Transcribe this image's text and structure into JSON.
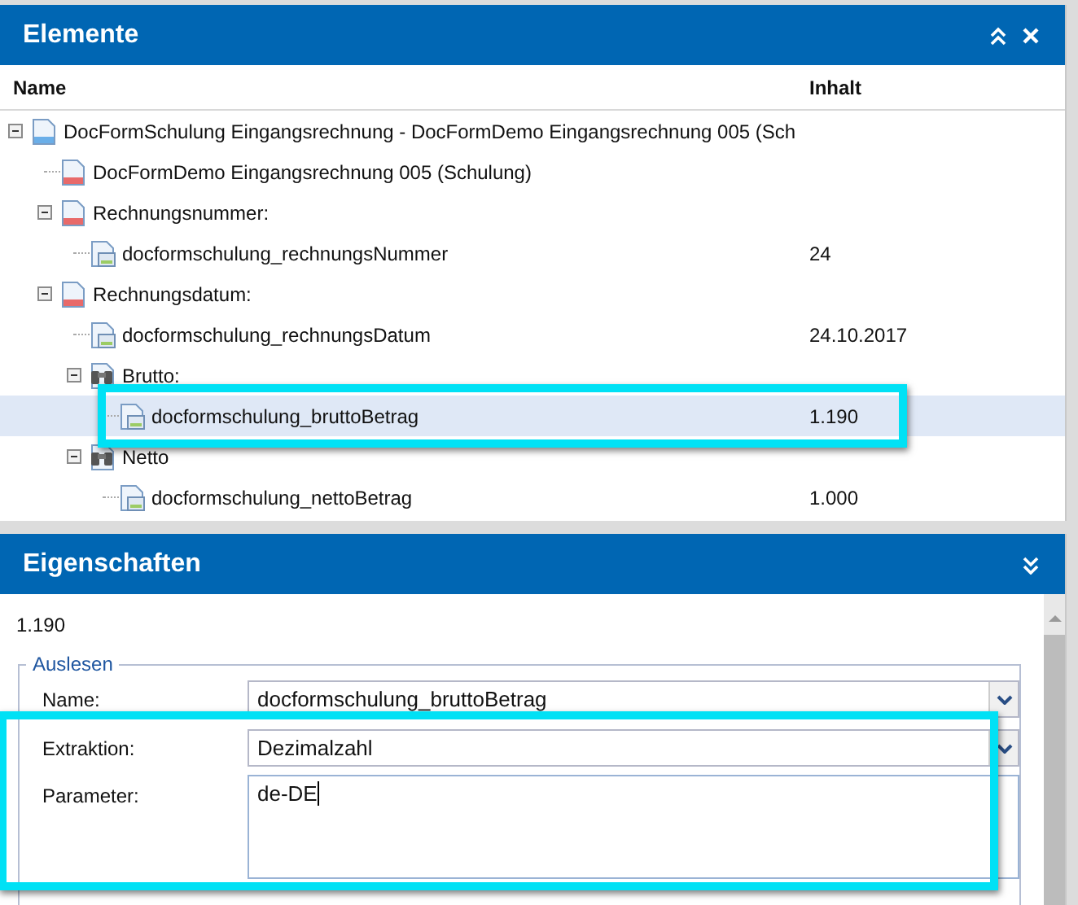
{
  "elements_panel": {
    "title": "Elemente",
    "columns": [
      "Name",
      "Inhalt"
    ],
    "tree": [
      {
        "label": "DocFormSchulung Eingangsrechnung - DocFormDemo Eingangsrechnung 005 (Sch",
        "kind": "doc-blue",
        "expanded": true,
        "selected": false,
        "children": [
          {
            "label": "DocFormDemo Eingangsrechnung 005 (Schulung)",
            "kind": "doc-red",
            "selected": false
          },
          {
            "label": "Rechnungsnummer:",
            "kind": "doc-red",
            "expanded": true,
            "selected": false,
            "children": [
              {
                "label": "docformschulung_rechnungsNummer",
                "kind": "field",
                "value": "24",
                "selected": false
              }
            ]
          },
          {
            "label": "Rechnungsdatum:",
            "kind": "doc-red",
            "expanded": true,
            "selected": false,
            "children": [
              {
                "label": "docformschulung_rechnungsDatum",
                "kind": "field",
                "value": "24.10.2017",
                "selected": false
              },
              {
                "label": "Brutto:",
                "kind": "binoculars",
                "expanded": true,
                "selected": false,
                "children": [
                  {
                    "label": "docformschulung_bruttoBetrag",
                    "kind": "field",
                    "value": "1.190",
                    "selected": true
                  }
                ]
              },
              {
                "label": "Netto",
                "kind": "binoculars",
                "expanded": true,
                "selected": false,
                "children": [
                  {
                    "label": "docformschulung_nettoBetrag",
                    "kind": "field",
                    "value": "1.000",
                    "selected": false
                  }
                ]
              }
            ]
          }
        ]
      }
    ]
  },
  "properties_panel": {
    "title": "Eigenschaften",
    "value": "1.190",
    "group": {
      "legend": "Auslesen",
      "fields": [
        {
          "label": "Name:",
          "kind": "combo",
          "value": "docformschulung_bruttoBetrag"
        },
        {
          "label": "Extraktion:",
          "kind": "combo",
          "value": "Dezimalzahl"
        },
        {
          "label": "Parameter:",
          "kind": "textarea",
          "value": "de-DE"
        }
      ]
    }
  }
}
